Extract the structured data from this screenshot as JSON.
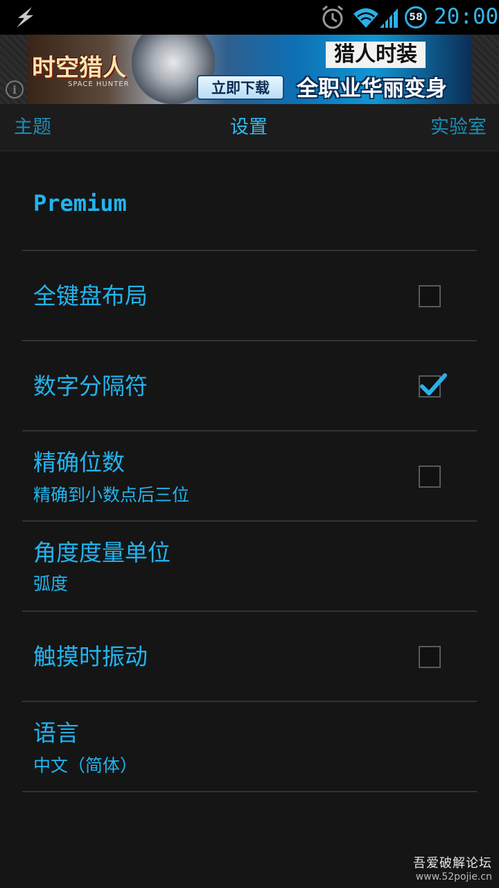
{
  "status_bar": {
    "time": "20:00",
    "battery": "58",
    "icons": [
      "charging-bolt-icon",
      "alarm-icon",
      "wifi-icon",
      "signal-icon",
      "battery-icon"
    ]
  },
  "ad": {
    "brand": "时空猎人",
    "brand_sub": "SPACE HUNTER",
    "download": "立即下载",
    "headline1": "猎人时装",
    "headline2": "全职业华丽变身",
    "info_icon": "i"
  },
  "tabs": {
    "theme": "主题",
    "settings": "设置",
    "lab": "实验室"
  },
  "preferences": {
    "premium": {
      "title": "Premium"
    },
    "full_keyboard": {
      "title": "全键盘布局",
      "checked": false
    },
    "digit_separator": {
      "title": "数字分隔符",
      "checked": true
    },
    "precision": {
      "title": "精确位数",
      "summary": "精确到小数点后三位",
      "checked": false
    },
    "angle_unit": {
      "title": "角度度量单位",
      "summary": "弧度"
    },
    "vibrate": {
      "title": "触摸时振动",
      "checked": false
    },
    "language": {
      "title": "语言",
      "summary": "中文（简体）"
    }
  },
  "watermark": {
    "line1": "吾爱破解论坛",
    "line2": "www.52pojie.cn"
  },
  "colors": {
    "accent": "#22b4ee",
    "background": "#151515",
    "divider": "#333333"
  }
}
